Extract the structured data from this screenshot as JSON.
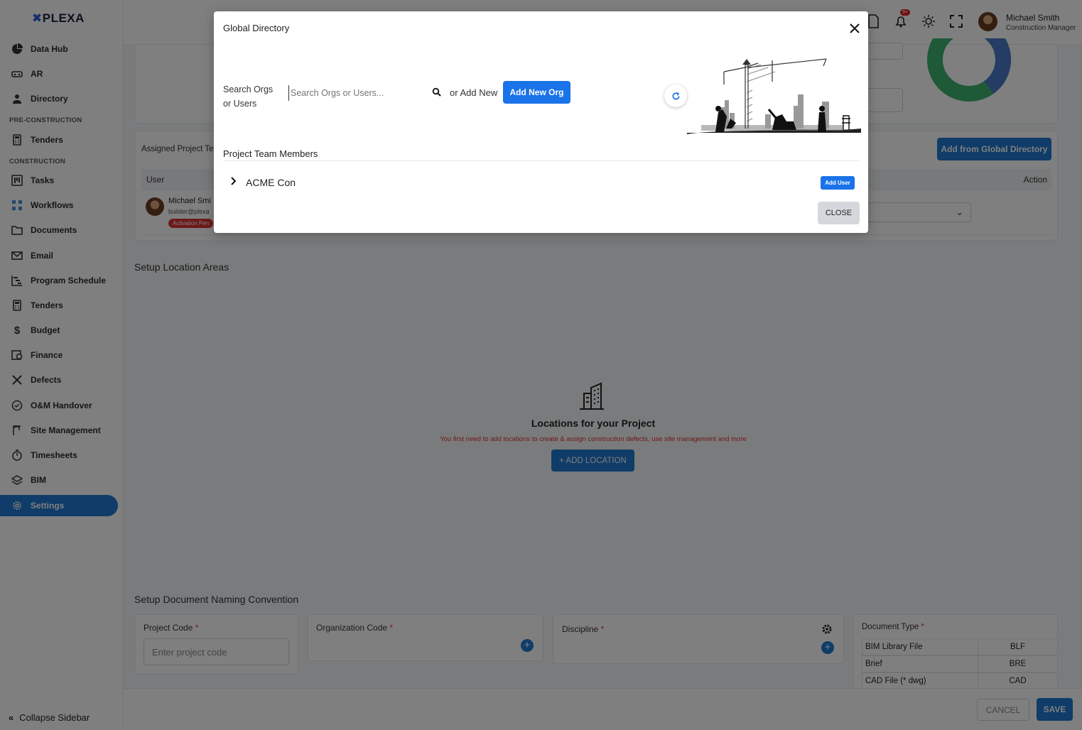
{
  "app": {
    "logo": "PLEXA"
  },
  "sidebar": {
    "items": [
      {
        "label": "Data Hub",
        "icon": "pie-chart-icon"
      },
      {
        "label": "AR",
        "icon": "headset-icon"
      },
      {
        "label": "Directory",
        "icon": "users-icon"
      },
      {
        "label": "Tenders",
        "icon": "calculator-icon"
      },
      {
        "label": "Tasks",
        "icon": "kanban-icon"
      },
      {
        "label": "Workflows",
        "icon": "workflow-icon"
      },
      {
        "label": "Documents",
        "icon": "folder-icon"
      },
      {
        "label": "Email",
        "icon": "envelope-icon"
      },
      {
        "label": "Program Schedule",
        "icon": "gantt-icon"
      },
      {
        "label": "Tenders",
        "icon": "calculator-icon"
      },
      {
        "label": "Budget",
        "icon": "dollar-icon"
      },
      {
        "label": "Finance",
        "icon": "finance-icon"
      },
      {
        "label": "Defects",
        "icon": "tools-icon"
      },
      {
        "label": "O&M Handover",
        "icon": "check-circle-icon"
      },
      {
        "label": "Site Management",
        "icon": "crane-icon"
      },
      {
        "label": "Timesheets",
        "icon": "stopwatch-icon"
      },
      {
        "label": "BIM",
        "icon": "layers-icon"
      },
      {
        "label": "Settings",
        "icon": "gear-icon"
      }
    ],
    "sections": {
      "pre_construction": "PRE-CONSTRUCTION",
      "construction": "CONSTRUCTION"
    },
    "collapse_label": "Collapse Sidebar"
  },
  "header": {
    "notifications_badge": "9+",
    "user_name": "Michael Smith",
    "user_role": "Construction Manager"
  },
  "team": {
    "label": "Assigned Project Tea",
    "add_button": "Add from Global Directory",
    "col_user": "User",
    "col_action": "Action",
    "member_name": "Michael Smi",
    "member_email": "builder@plexa",
    "member_status": "Activation Pen"
  },
  "locations": {
    "section_title": "Setup Location Areas",
    "heading": "Locations for your Project",
    "hint": "You first need to add locations to create & assign construction defects, use site management and more",
    "add_button": "+ ADD LOCATION"
  },
  "naming": {
    "section_title": "Setup Document Naming Convention",
    "project_code_label": "Project Code",
    "project_code_placeholder": "Enter project code",
    "org_code_label": "Organization Code",
    "discipline_label": "Discipline",
    "doc_type_label": "Document Type",
    "doc_types": [
      {
        "name": "BIM Library File",
        "code": "BLF"
      },
      {
        "name": "Brief",
        "code": "BRE"
      },
      {
        "name": "CAD File (* dwg)",
        "code": "CAD"
      }
    ],
    "required_mark": "*"
  },
  "footer": {
    "cancel": "CANCEL",
    "save": "SAVE"
  },
  "modal": {
    "title": "Global Directory",
    "search_label": "Search Orgs or Users",
    "search_placeholder": "Search Orgs or Users...",
    "or_add_new": "or Add New",
    "add_new_org": "Add New Org",
    "team_members_label": "Project Team Members",
    "org_name": "ACME Con",
    "add_user": "Add User",
    "close": "CLOSE"
  },
  "colors": {
    "primary": "#1f78d1",
    "danger": "#d33",
    "donut_green": "#3cb371",
    "donut_blue": "#4a78c9"
  }
}
